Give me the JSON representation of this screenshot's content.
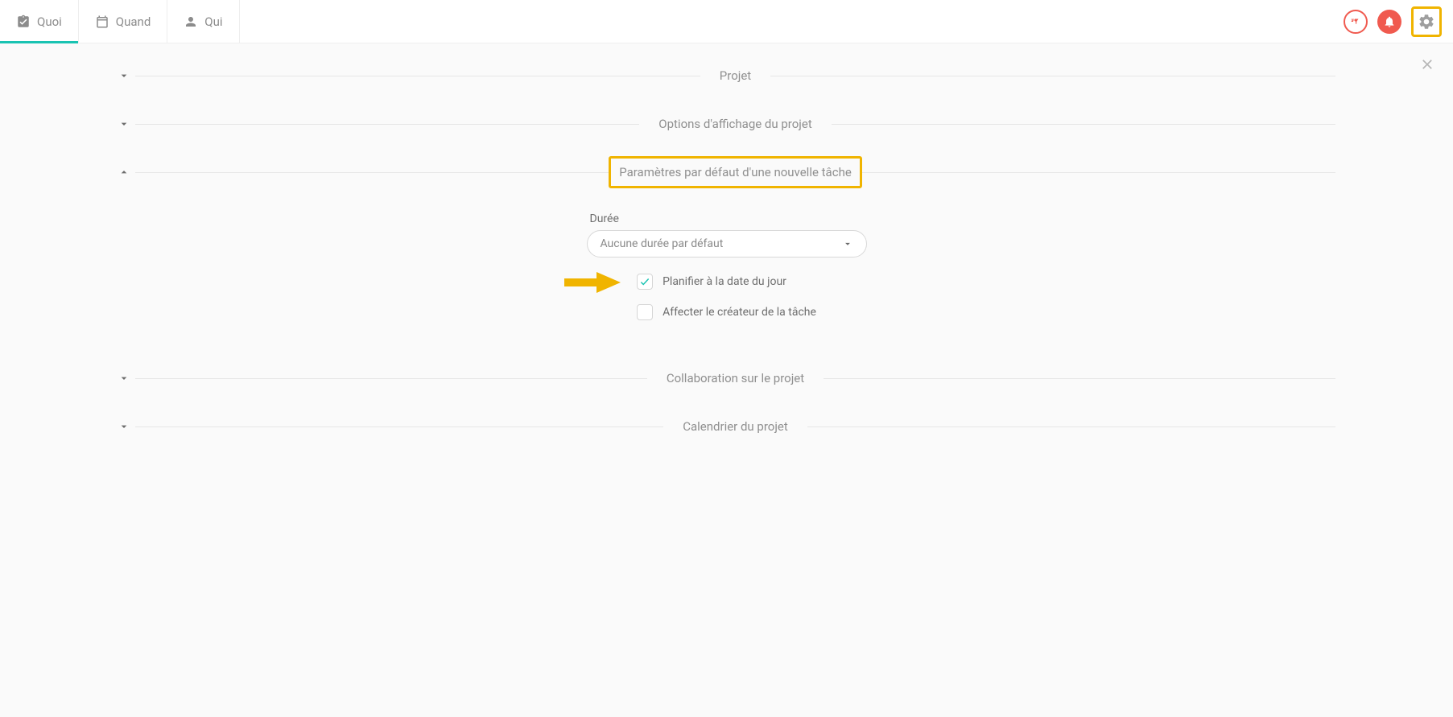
{
  "topbar": {
    "tabs": [
      {
        "label": "Quoi"
      },
      {
        "label": "Quand"
      },
      {
        "label": "Qui"
      }
    ]
  },
  "sections": {
    "projet": {
      "title": "Projet"
    },
    "options_affichage": {
      "title": "Options d'affichage du projet"
    },
    "defauts_tache": {
      "title": "Paramètres par défaut d'une nouvelle tâche",
      "duree_label": "Durée",
      "duree_value": "Aucune durée par défaut",
      "check_planifier": "Planifier à la date du jour",
      "check_affecter": "Affecter le créateur de la tâche"
    },
    "collaboration": {
      "title": "Collaboration sur le projet"
    },
    "calendrier": {
      "title": "Calendrier du projet"
    }
  }
}
